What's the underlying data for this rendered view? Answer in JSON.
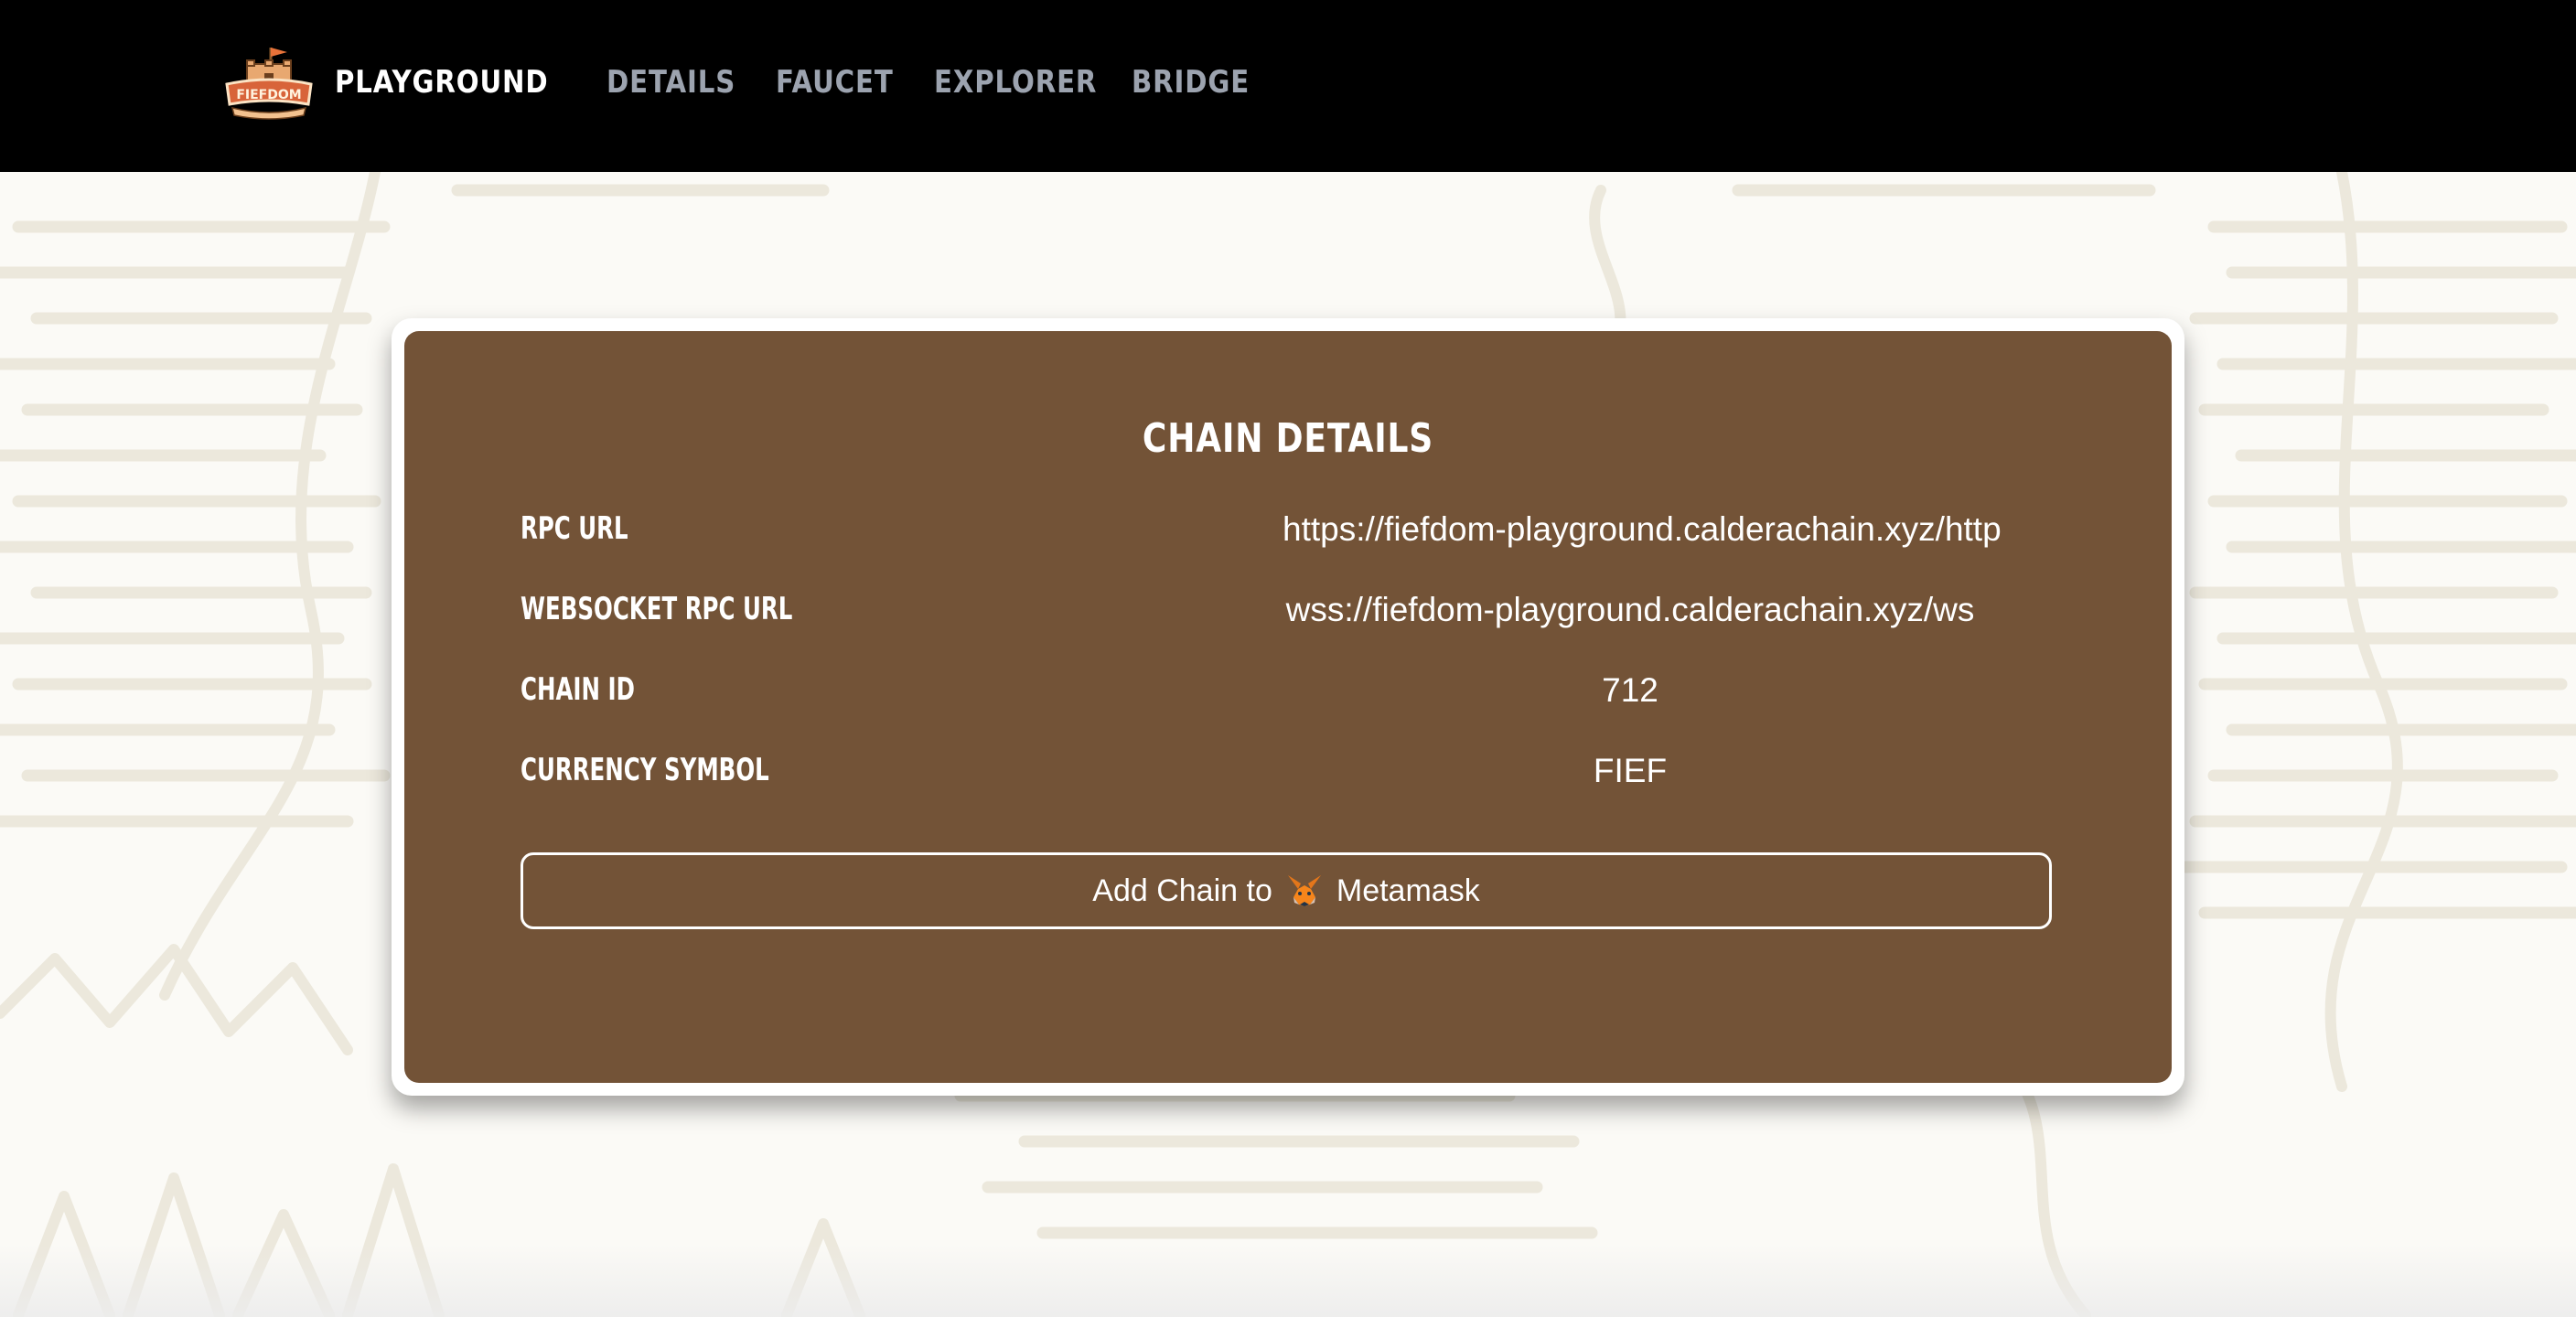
{
  "header": {
    "brand_name": "PLAYGROUND",
    "logo_icon": "fiefdom-castle-logo-icon",
    "nav": [
      {
        "label": "DETAILS"
      },
      {
        "label": "FAUCET"
      },
      {
        "label": "EXPLORER"
      },
      {
        "label": "BRIDGE"
      }
    ]
  },
  "card": {
    "title": "CHAIN DETAILS",
    "rows": [
      {
        "label": "RPC URL",
        "value": "https://fiefdom-playground.calderachain.xyz/http"
      },
      {
        "label": "WEBSOCKET RPC URL",
        "value": "wss://fiefdom-playground.calderachain.xyz/ws"
      },
      {
        "label": "CHAIN ID",
        "value": "712"
      },
      {
        "label": "CURRENCY SYMBOL",
        "value": "FIEF"
      }
    ],
    "add_button": {
      "prefix": "Add Chain to",
      "suffix": "Metamask",
      "icon": "metamask-fox-icon"
    }
  },
  "colors": {
    "header_bg": "#000000",
    "nav_text": "#9ca3af",
    "card_bg": "#735337",
    "card_border": "#ffffff",
    "page_bg": "#fbfaf6",
    "map_lines": "#ece8dc"
  }
}
